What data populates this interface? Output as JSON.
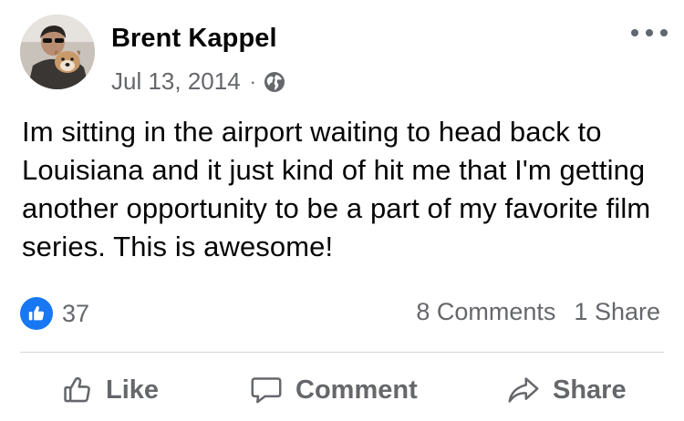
{
  "post": {
    "author_name": "Brent Kappel",
    "date": "Jul 13, 2014",
    "separator": "·",
    "privacy_icon": "globe-icon",
    "body": "Im sitting in the airport waiting to head back to Louisiana and it just kind of hit me that I'm getting another opportunity to be a part of my favorite film series. This is awesome!"
  },
  "stats": {
    "reaction_icon": "like-reaction-icon",
    "reaction_count": "37",
    "comments": "8 Comments",
    "shares": "1 Share"
  },
  "actions": {
    "like_label": "Like",
    "comment_label": "Comment",
    "share_label": "Share"
  },
  "colors": {
    "accent": "#1877f2",
    "secondary_text": "#65676b",
    "primary_text": "#050505",
    "divider": "#d4d6da"
  }
}
